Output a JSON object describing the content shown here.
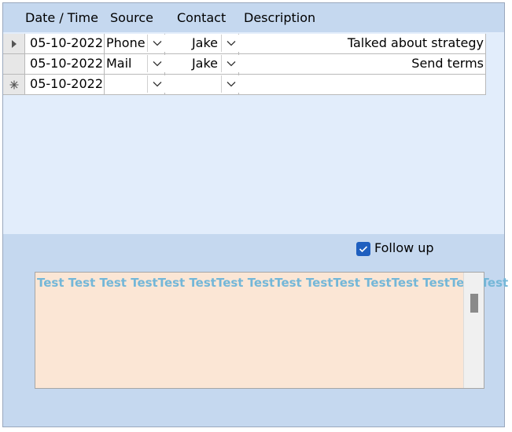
{
  "columns": [
    "Date / Time",
    "Source",
    "Contact",
    "Description"
  ],
  "rows": [
    {
      "date": "05-10-2022",
      "source": "Phone",
      "contact": "Jake",
      "description": "Talked about strategy"
    },
    {
      "date": "05-10-2022",
      "source": "Mail",
      "contact": "Jake",
      "description": "Send terms"
    },
    {
      "date": "05-10-2022",
      "source": "",
      "contact": "",
      "description": ""
    }
  ],
  "follow_up": {
    "label": "Follow up",
    "checked": true
  },
  "memo": {
    "text": "Test Test Test TestTest TestTest TestTest TestTest TestTest TestTest Test"
  },
  "colors": {
    "header_bg": "#c5d8ef",
    "datasheet_bg": "#e2edfb",
    "memo_bg": "#fbe6d5",
    "memo_text": "#74b7d8",
    "checkbox": "#1f5fbf"
  }
}
